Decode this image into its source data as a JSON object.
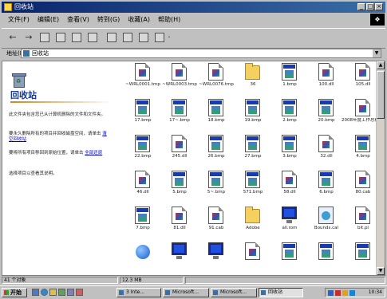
{
  "window": {
    "title": "回收站"
  },
  "menu": [
    "文件(F)",
    "编辑(E)",
    "查看(V)",
    "转到(G)",
    "收藏(A)",
    "帮助(H)"
  ],
  "address": {
    "label": "地址(D)",
    "value": "回收站"
  },
  "left_pane": {
    "title": "回收站",
    "p1": "此文件夹包含您已从计算机删除的文件和文件夹。",
    "p2": "要永久删除所有的项目并回收磁盘空间，请单击",
    "p2_link": "清空回收站",
    "p3": "要将所有项目移回到原始位置，请单击",
    "p3_link": "全部还原",
    "p4": "选择项目以查看其说明。"
  },
  "files": [
    {
      "name": "~WRL0001.tmp",
      "icon": "doc"
    },
    {
      "name": "~WRL0003.tmp",
      "icon": "doc"
    },
    {
      "name": "~WRL0076.tmp",
      "icon": "doc"
    },
    {
      "name": "36",
      "icon": "folder"
    },
    {
      "name": "1.bmp",
      "icon": "bmp"
    },
    {
      "name": "100.dll",
      "icon": "doc"
    },
    {
      "name": "105.dll",
      "icon": "doc"
    },
    {
      "name": "17.bmp",
      "icon": "bmp"
    },
    {
      "name": "17~.bmp",
      "icon": "bmp"
    },
    {
      "name": "18.bmp",
      "icon": "bmp"
    },
    {
      "name": "19.bmp",
      "icon": "bmp"
    },
    {
      "name": "2.bmp",
      "icon": "bmp"
    },
    {
      "name": "20.bmp",
      "icon": "bmp"
    },
    {
      "name": "2008年度工作总结.doc",
      "icon": "doc"
    },
    {
      "name": "22.bmp",
      "icon": "bmp"
    },
    {
      "name": "245.dll",
      "icon": "doc"
    },
    {
      "name": "26.bmp",
      "icon": "bmp"
    },
    {
      "name": "27.bmp",
      "icon": "bmp"
    },
    {
      "name": "3.bmp",
      "icon": "bmp"
    },
    {
      "name": "32.dll",
      "icon": "doc"
    },
    {
      "name": "4.bmp",
      "icon": "bmp"
    },
    {
      "name": "46.dll",
      "icon": "doc"
    },
    {
      "name": "5.bmp",
      "icon": "bmp"
    },
    {
      "name": "5~.bmp",
      "icon": "bmp"
    },
    {
      "name": "571.bmp",
      "icon": "bmp"
    },
    {
      "name": "58.dll",
      "icon": "doc"
    },
    {
      "name": "6.bmp",
      "icon": "bmp"
    },
    {
      "name": "80.cab",
      "icon": "doc"
    },
    {
      "name": "7.bmp",
      "icon": "bmp"
    },
    {
      "name": "81.dll",
      "icon": "doc"
    },
    {
      "name": "91.cab",
      "icon": "doc"
    },
    {
      "name": "Adobe",
      "icon": "folder"
    },
    {
      "name": "all.rom",
      "icon": "scr"
    },
    {
      "name": "Bounds.cal",
      "icon": "gear"
    },
    {
      "name": "bit.pl",
      "icon": "doc"
    },
    {
      "name": "",
      "icon": "ball"
    },
    {
      "name": "",
      "icon": "scr"
    },
    {
      "name": "",
      "icon": "scr"
    },
    {
      "name": "",
      "icon": "doc"
    },
    {
      "name": "",
      "icon": "bmp"
    },
    {
      "name": "",
      "icon": "bmp"
    },
    {
      "name": "",
      "icon": "bmp"
    }
  ],
  "status": {
    "count": "41 个对象",
    "size": "12.3 MB"
  },
  "taskbar": {
    "start": "开始",
    "tasks": [
      "3 Inte...",
      "Microsoft...",
      "Microsoft...",
      "回收站"
    ],
    "clock": "10:34"
  }
}
